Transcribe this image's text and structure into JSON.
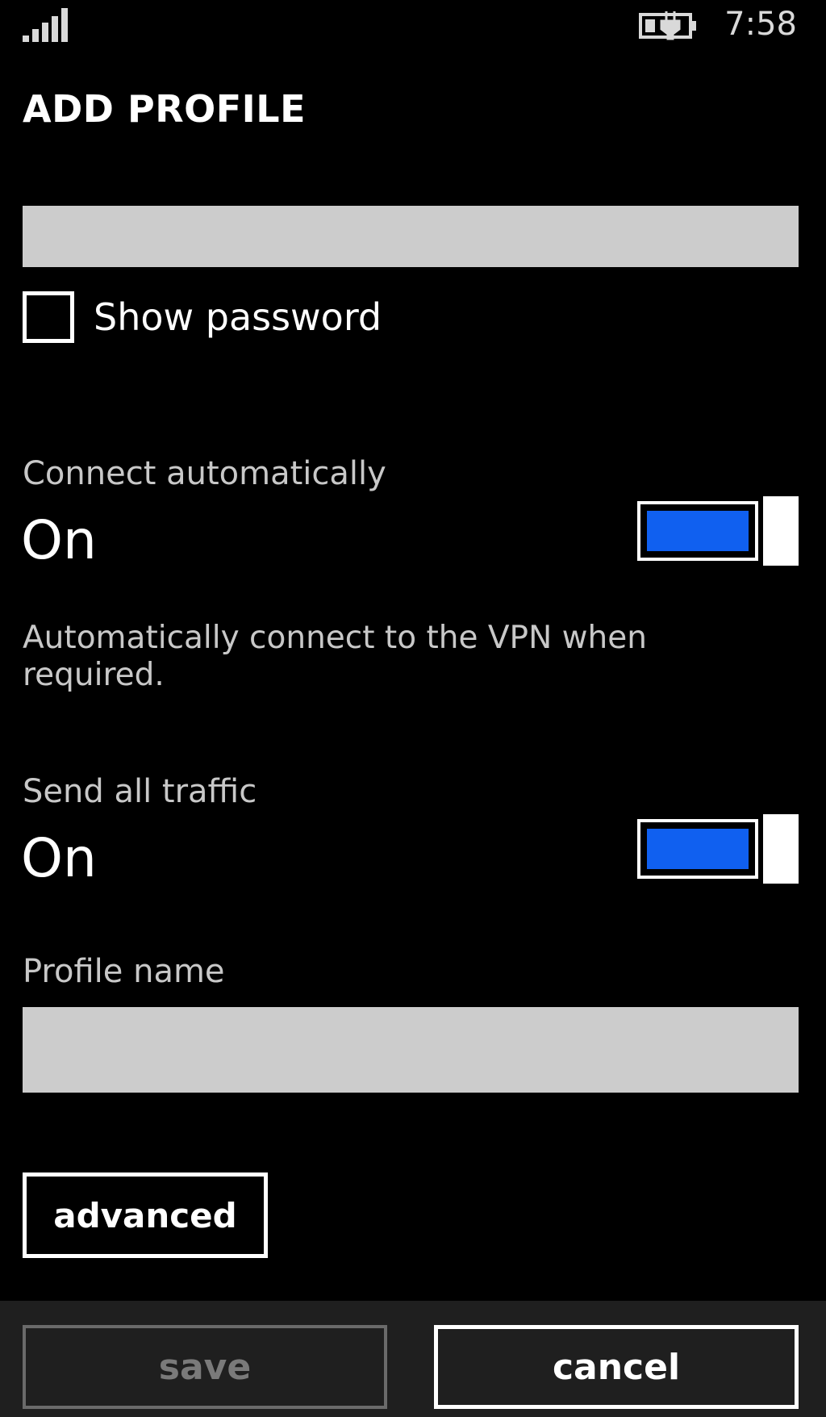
{
  "status_bar": {
    "time": "7:58",
    "signal_icon": "signal-strength-icon",
    "battery_icon": "battery-charging-icon"
  },
  "page": {
    "title": "ADD PROFILE"
  },
  "password": {
    "value": "",
    "show_password_label": "Show password",
    "show_password_checked": false
  },
  "connect_automatically": {
    "header": "Connect automatically",
    "value": "On",
    "enabled": true,
    "description": "Automatically connect to the VPN when required."
  },
  "send_all_traffic": {
    "header": "Send all traffic",
    "value": "On",
    "enabled": true
  },
  "profile_name": {
    "header": "Profile name",
    "value": ""
  },
  "buttons": {
    "advanced": "advanced",
    "save": "save",
    "cancel": "cancel"
  },
  "colors": {
    "accent": "#1060f0",
    "background": "#000000",
    "app_bar": "#1f1f1f",
    "input_background": "#cccccc"
  }
}
